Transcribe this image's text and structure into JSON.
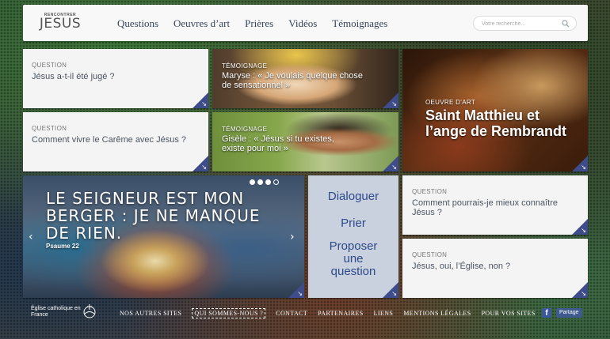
{
  "header": {
    "logo_small": "RENCONTRER",
    "logo_big": "JESUS",
    "nav": [
      "Questions",
      "Oeuvres d’art",
      "Prières",
      "Vidéos",
      "Témoignages"
    ],
    "search_placeholder": "Votre recherche..."
  },
  "tiles": {
    "q1": {
      "kicker": "QUESTION",
      "title": "Jésus a-t-il été jugé ?"
    },
    "q2": {
      "kicker": "QUESTION",
      "title": "Comment vivre le Carême avec Jésus ?"
    },
    "maryse": {
      "kicker": "TÉMOIGNAGE",
      "title": "Maryse : « Je voulais quelque chose de sensationnel »"
    },
    "gisele": {
      "kicker": "TÉMOIGNAGE",
      "title": "Gisèle : « Jésus si tu existes, existe pour moi »"
    },
    "matthieu": {
      "kicker": "OEUVRE D’ART",
      "title": "Saint Matthieu et l’ange de Rembrandt"
    },
    "q3": {
      "kicker": "QUESTION",
      "title": "Comment pourrais-je mieux connaître Jésus ?"
    },
    "q4": {
      "kicker": "QUESTION",
      "title": "Jésus, oui, l’Église, non ?"
    }
  },
  "verse": {
    "quote": "LE SEIGNEUR EST MON BERGER : JE NE MANQUE DE RIEN.",
    "reference": "Psaume 22"
  },
  "actions": [
    "Dialoguer",
    "Prier",
    "Proposer une question"
  ],
  "footer": {
    "org": "Église catholique en France",
    "links": [
      "NOS AUTRES SITES",
      "QUI SOMMES-NOUS ?",
      "CONTACT",
      "PARTENAIRES",
      "LIENS",
      "MENTIONS LÉGALES",
      "POUR VOS SITES"
    ],
    "facebook": "f",
    "share": "Partage"
  },
  "icons": {
    "search": "search-icon",
    "prev": "‹",
    "next": "›",
    "corner_arrow": "↘"
  },
  "colors": {
    "accent": "#3e4d8a",
    "nav_text": "#35455a",
    "actions_bg": "#c9d1df",
    "actions_text": "#2e4a8a"
  }
}
